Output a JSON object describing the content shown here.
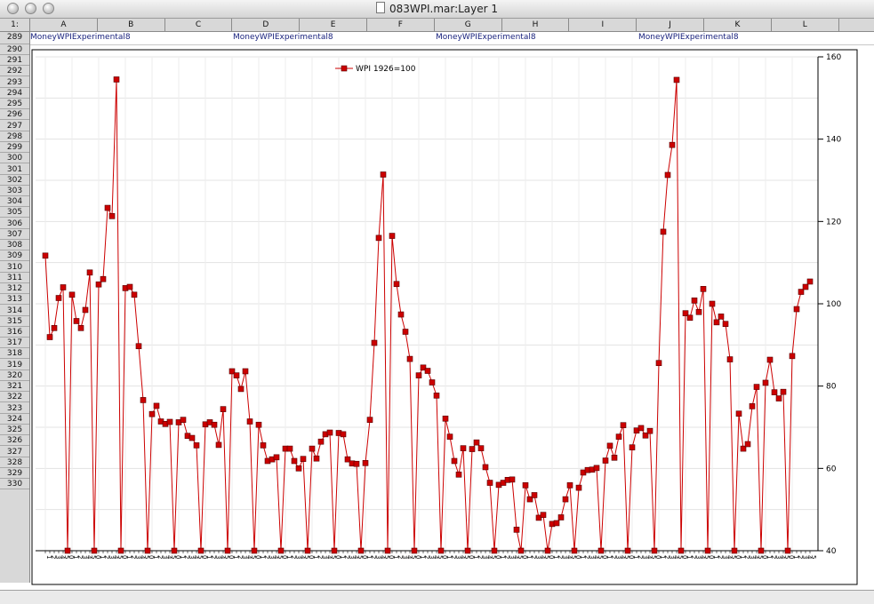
{
  "window": {
    "title": "083WPI.mar:Layer 1"
  },
  "columns": [
    "A",
    "B",
    "C",
    "D",
    "E",
    "F",
    "G",
    "H",
    "I",
    "J",
    "K",
    "L"
  ],
  "corner_label": "1:",
  "rows": [
    "289",
    "290",
    "291",
    "292",
    "293",
    "294",
    "295",
    "296",
    "297",
    "298",
    "299",
    "300",
    "301",
    "302",
    "303",
    "304",
    "305",
    "306",
    "307",
    "308",
    "309",
    "310",
    "311",
    "312",
    "313",
    "314",
    "315",
    "316",
    "317",
    "318",
    "319",
    "320",
    "321",
    "322",
    "323",
    "324",
    "325",
    "326",
    "327",
    "328",
    "329",
    "330"
  ],
  "row289_cells": [
    "MoneyWPIExperimental8",
    "MoneyWPIExperimental8",
    "MoneyWPIExperimental8",
    "MoneyWPIExperimental8"
  ],
  "chart_data": {
    "type": "line",
    "title": "",
    "xlabel": "",
    "ylabel": "",
    "ylim": [
      40,
      160
    ],
    "yticks": [
      40,
      60,
      80,
      100,
      120,
      140,
      160
    ],
    "y_axis_side": "right",
    "legend": "top-center",
    "grid": true,
    "series": [
      {
        "name": "WPI 1926=100",
        "color": "#cc0000",
        "values": [
          111.7,
          91.9,
          94.1,
          101.4,
          104,
          40,
          102.2,
          95.8,
          94.1,
          98.5,
          107.6,
          40,
          104.7,
          106,
          123.3,
          121.3,
          154.5,
          40,
          103.8,
          104.1,
          102.2,
          89.7,
          76.6,
          40,
          73.2,
          75.2,
          71.4,
          70.8,
          71.3,
          40,
          71.2,
          71.8,
          67.9,
          67.4,
          65.6,
          40,
          70.7,
          71.2,
          70.6,
          65.7,
          74.4,
          40,
          83.6,
          82.6,
          79.3,
          83.6,
          71.4,
          40,
          70.6,
          65.6,
          61.8,
          62.2,
          62.7,
          40,
          64.8,
          64.8,
          61.8,
          60,
          62.3,
          40,
          64.8,
          62.4,
          66.5,
          68.3,
          68.7,
          40,
          68.6,
          68.3,
          62.2,
          61.2,
          61.1,
          40,
          61.3,
          71.8,
          90.5,
          116,
          131.4,
          40,
          116.5,
          104.8,
          97.4,
          93.2,
          86.6,
          40,
          82.6,
          84.5,
          83.7,
          80.9,
          77.7,
          40,
          72.1,
          67.7,
          61.8,
          58.5,
          64.9,
          40,
          64.7,
          66.3,
          64.9,
          60.3,
          56.5,
          40,
          56,
          56.5,
          57.2,
          57.3,
          45.1,
          40,
          55.9,
          52.5,
          53.5,
          48,
          48.7,
          40,
          46.5,
          46.7,
          48.1,
          52.5,
          55.9,
          40,
          55.3,
          59,
          59.6,
          59.7,
          60.1,
          40,
          61.9,
          65.5,
          62.6,
          67.7,
          70.5,
          40,
          65.1,
          69.2,
          69.8,
          68,
          69.1,
          40,
          85.6,
          117.5,
          131.3,
          138.6,
          154.4,
          40,
          97.7,
          96.6,
          100.8,
          98,
          103.6,
          40,
          100,
          95.5,
          96.9,
          95.1,
          86.5,
          40,
          73.3,
          64.8,
          65.9,
          75.1,
          79.8,
          40,
          80.8,
          86.4,
          78.5,
          77,
          78.6,
          40,
          87.3,
          98.7,
          102.9,
          104.1,
          105.4
        ]
      }
    ],
    "x_tick_labels": [
      "1",
      "2",
      "3",
      "4",
      "5",
      "0",
      "1",
      "2",
      "3",
      "4",
      "5",
      "0",
      "1",
      "2",
      "3",
      "4",
      "5",
      "0",
      "1",
      "2",
      "3",
      "4",
      "5",
      "0",
      "1",
      "2",
      "3",
      "4",
      "5",
      "0",
      "1",
      "2",
      "3",
      "4",
      "5",
      "0",
      "1",
      "2",
      "3",
      "4",
      "5",
      "0",
      "1",
      "2",
      "3",
      "4",
      "5",
      "0",
      "1",
      "2",
      "3",
      "4",
      "5",
      "0",
      "1",
      "2",
      "3",
      "4",
      "5",
      "0",
      "1",
      "2",
      "3",
      "4",
      "5",
      "0",
      "1",
      "2",
      "3",
      "4",
      "5",
      "0",
      "1",
      "2",
      "3",
      "4",
      "5",
      "0",
      "1",
      "2",
      "3",
      "4",
      "5",
      "0",
      "1",
      "2",
      "3",
      "4",
      "5",
      "0",
      "1",
      "2",
      "3",
      "4",
      "5",
      "0",
      "1",
      "2",
      "3",
      "4",
      "5",
      "0",
      "1",
      "2",
      "3",
      "4",
      "5",
      "0",
      "1",
      "2",
      "3",
      "4",
      "5",
      "0",
      "1",
      "2",
      "3",
      "4",
      "5",
      "0",
      "1",
      "2",
      "3",
      "4",
      "5",
      "0",
      "1",
      "2",
      "3",
      "4",
      "5",
      "0",
      "1",
      "2",
      "3",
      "4",
      "5",
      "0",
      "1",
      "2",
      "3",
      "4",
      "5",
      "0",
      "1",
      "2",
      "3",
      "4",
      "5",
      "0",
      "1",
      "2",
      "3",
      "4",
      "5",
      "0",
      "1",
      "2",
      "3",
      "4",
      "5",
      "0",
      "1",
      "2",
      "3",
      "4",
      "5",
      "0",
      "1",
      "2",
      "3",
      "4",
      "5",
      "0",
      "1",
      "2",
      "3",
      "4",
      "5"
    ]
  }
}
